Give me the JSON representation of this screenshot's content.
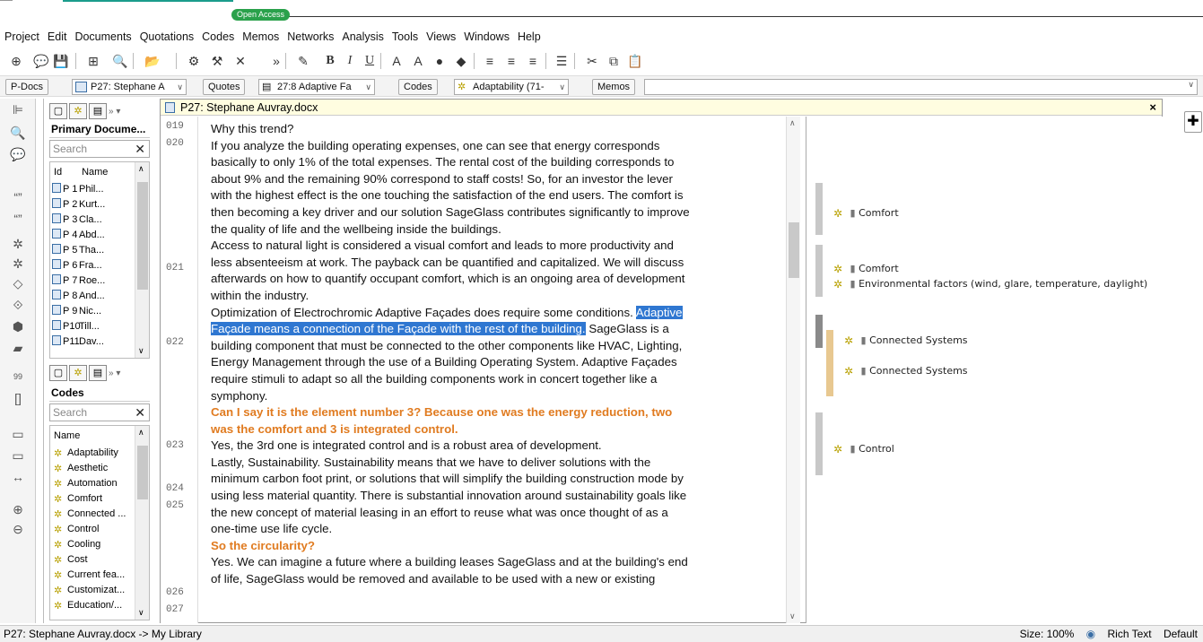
{
  "journal": {
    "badge": "Open Access"
  },
  "menu": [
    "Project",
    "Edit",
    "Documents",
    "Quotations",
    "Codes",
    "Memos",
    "Networks",
    "Analysis",
    "Tools",
    "Views",
    "Windows",
    "Help"
  ],
  "navigator": {
    "pdocs_label": "P-Docs",
    "pdoc_value": "P27: Stephane A",
    "quotes_label": "Quotes",
    "quote_value": "27:8 Adaptive Fa",
    "codes_label": "Codes",
    "code_value": "Adaptability (71-",
    "memos_label": "Memos"
  },
  "primary_docs": {
    "title": "Primary Docume...",
    "search_placeholder": "Search",
    "col_id": "Id",
    "col_name": "Name",
    "rows": [
      {
        "id": "P 1",
        "name": "Phil..."
      },
      {
        "id": "P 2",
        "name": "Kurt..."
      },
      {
        "id": "P 3",
        "name": "Cla..."
      },
      {
        "id": "P 4",
        "name": "Abd..."
      },
      {
        "id": "P 5",
        "name": "Tha..."
      },
      {
        "id": "P 6",
        "name": "Fra..."
      },
      {
        "id": "P 7",
        "name": "Roe..."
      },
      {
        "id": "P 8",
        "name": "And..."
      },
      {
        "id": "P 9",
        "name": "Nic..."
      },
      {
        "id": "P10",
        "name": "Till..."
      },
      {
        "id": "P11",
        "name": "Dav..."
      }
    ]
  },
  "codes_panel": {
    "title": "Codes",
    "search_placeholder": "Search",
    "col_name": "Name",
    "rows": [
      "Adaptability",
      "Aesthetic",
      "Automation",
      "Comfort",
      "Connected ...",
      "Control",
      "Cooling",
      "Cost",
      "Current fea...",
      "Customizat...",
      "Education/..."
    ]
  },
  "document": {
    "title": "P27: Stephane Auvray.docx",
    "paragraph_numbers": [
      "019",
      "020",
      "021",
      "022",
      "023",
      "024",
      "025",
      "026",
      "027"
    ],
    "lines": [
      {
        "t": "Why this trend?"
      },
      {
        "t": "If you analyze the building operating expenses, one can see that energy corresponds"
      },
      {
        "t": "basically to only 1% of the total expenses. The rental cost of the building corresponds to"
      },
      {
        "t": "about 9% and the remaining 90% correspond to staff costs! So, for an investor the lever"
      },
      {
        "t": "with the highest effect is the one touching the satisfaction of the end users. The comfort is"
      },
      {
        "t": "then becoming a key driver and our solution SageGlass contributes significantly to improve"
      },
      {
        "t": "the quality of life and the wellbeing inside the buildings."
      },
      {
        "t": "Access to natural light is considered a visual comfort and leads to more productivity and"
      },
      {
        "t": "less absenteeism at work. The payback can be quantified and capitalized. We will discuss"
      },
      {
        "t": "afterwards on how to quantify occupant comfort, which is an ongoing area of development"
      },
      {
        "t": "within the industry."
      },
      {
        "t": "Optimization of Electrochromic Adaptive Façades does require some conditions. ",
        "h": "Adaptive"
      },
      {
        "h": "Façade means a connection of the Façade with the rest of the building.",
        "t2": " SageGlass is a"
      },
      {
        "t": "building component that must be connected to the other components like HVAC, Lighting,"
      },
      {
        "t": "Energy Management through the use of a Building Operating System.  Adaptive Façades"
      },
      {
        "t": "require stimuli to adapt so all the building components work in concert together like a"
      },
      {
        "t": "symphony."
      },
      {
        "q": "Can I say it is the element number 3? Because one was the energy reduction, two"
      },
      {
        "q": "was the comfort and 3 is integrated control."
      },
      {
        "t": "Yes, the 3rd one is integrated control and is a robust area of development."
      },
      {
        "t": "Lastly, Sustainability.  Sustainability means that we have to deliver solutions with the"
      },
      {
        "t": "minimum carbon foot print, or solutions that will simplify the building construction mode by"
      },
      {
        "t": "using less material quantity.  There is substantial innovation around sustainability goals like"
      },
      {
        "t": "the new concept of material leasing in an effort to reuse what was once thought of as a"
      },
      {
        "t": "one-time use life cycle."
      },
      {
        "q": "So the circularity?"
      },
      {
        "t": "Yes. We can imagine a future where a building leases SageGlass and at the building's end"
      },
      {
        "t": "of life, SageGlass would be removed and available to be used with a new or existing"
      }
    ]
  },
  "margin_codes": [
    {
      "label": "Comfort"
    },
    {
      "label": "Comfort"
    },
    {
      "label": "Environmental factors (wind, glare, temperature, daylight)"
    },
    {
      "label": "Connected Systems"
    },
    {
      "label": "Connected Systems"
    },
    {
      "label": "Control"
    }
  ],
  "status": {
    "path": "P27: Stephane Auvray.docx -> My Library",
    "size": "Size: 100%",
    "format": "Rich Text",
    "style": "Default"
  },
  "colors": {
    "highlight": "#2f77d1",
    "question": "#e07b20",
    "code_icon": "#b8a000"
  }
}
